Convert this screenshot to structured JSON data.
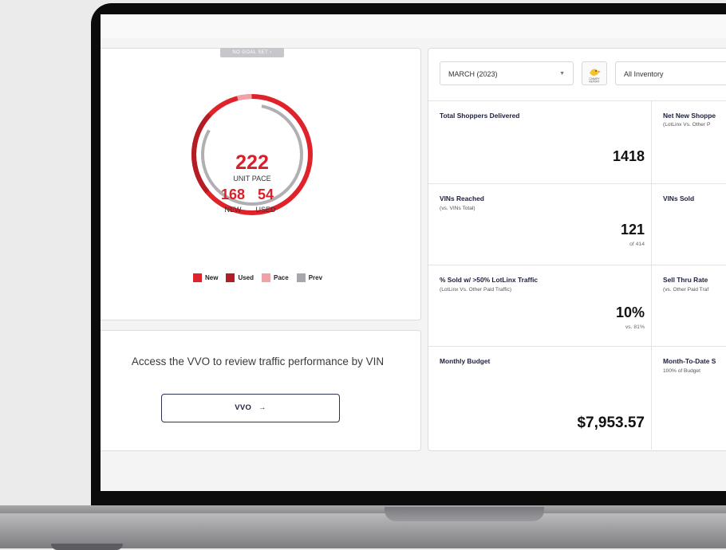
{
  "goal": {
    "pill": "NO GOAL SET",
    "pill_arrow": "›",
    "pace_value": "222",
    "pace_label": "UNIT PACE",
    "new_value": "168",
    "new_label": "NEW",
    "used_value": "54",
    "used_label": "USED",
    "legend": [
      {
        "label": "New",
        "color": "#e0232b"
      },
      {
        "label": "Used",
        "color": "#b51d24"
      },
      {
        "label": "Pace",
        "color": "#f0a3a6"
      },
      {
        "label": "Prev",
        "color": "#a7a7ab"
      }
    ]
  },
  "vvo": {
    "text": "Access the VVO to review traffic performance by VIN",
    "button_label": "VVO",
    "button_arrow": "→"
  },
  "toolbar": {
    "month_select": "MARCH (2023)",
    "canary_label": "CANARY REPORT",
    "inventory_select": "All Inventory"
  },
  "kpis": {
    "total_shoppers": {
      "title": "Total Shoppers Delivered",
      "value": "1418"
    },
    "net_new": {
      "title": "Net New Shoppe",
      "sub": "(LotLinx Vs. Other P"
    },
    "vins_reached": {
      "title": "VINs Reached",
      "sub": "(vs. VINs Total)",
      "value": "121",
      "of": "of 414"
    },
    "vins_sold": {
      "title": "VINs Sold"
    },
    "pct_sold": {
      "title": "% Sold w/ >50% LotLinx Traffic",
      "sub": "(LotLinx Vs. Other Paid Traffic)",
      "value": "10%",
      "vs": "vs. 81%"
    },
    "sell_thru": {
      "title": "Sell Thru Rate",
      "sub": "(vs. Other Paid Traf"
    },
    "monthly_budget": {
      "title": "Monthly Budget",
      "value": "$7,953.57"
    },
    "mtd": {
      "title": "Month-To-Date S",
      "sub": "100% of Budget"
    }
  },
  "colors": {
    "accent_red": "#d9202a",
    "navy": "#1c1f3d"
  }
}
